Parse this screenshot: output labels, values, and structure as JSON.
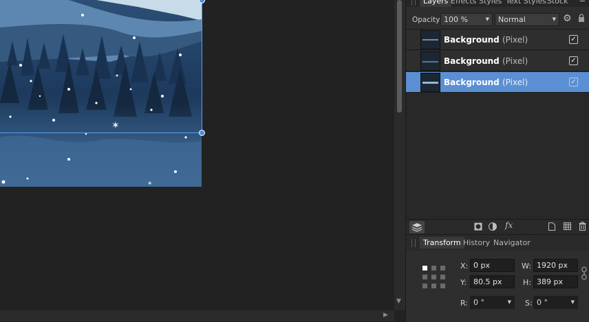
{
  "layers_panel": {
    "tabs": [
      {
        "label": "Layers",
        "active": true
      },
      {
        "label": "Effects",
        "active": false
      },
      {
        "label": "Styles",
        "active": false
      },
      {
        "label": "Text Styles",
        "active": false
      },
      {
        "label": "Stock",
        "active": false
      }
    ],
    "opacity_label": "Opacity:",
    "opacity_value": "100 %",
    "blend_mode": "Normal",
    "layers": [
      {
        "name": "Background",
        "type": "(Pixel)",
        "visible": true,
        "selected": false
      },
      {
        "name": "Background",
        "type": "(Pixel)",
        "visible": true,
        "selected": false
      },
      {
        "name": "Background",
        "type": "(Pixel)",
        "visible": true,
        "selected": true
      }
    ],
    "footer_icons": [
      "layers-stack-icon",
      "mask-icon",
      "adjustment-icon",
      "fx-icon",
      "new-layer-icon",
      "group-icon",
      "trash-icon"
    ],
    "fx_glyph": "fx",
    "check_glyph": "✓"
  },
  "transform_panel": {
    "tabs": [
      {
        "label": "Transform",
        "active": true
      },
      {
        "label": "History",
        "active": false
      },
      {
        "label": "Navigator",
        "active": false
      }
    ],
    "x_label": "X:",
    "x_value": "0 px",
    "y_label": "Y:",
    "y_value": "80.5 px",
    "w_label": "W:",
    "w_value": "1920 px",
    "h_label": "H:",
    "h_value": "389 px",
    "r_label": "R:",
    "r_value": "0 °",
    "s_label": "S:",
    "s_value": "0 °"
  },
  "colors": {
    "selection_accent": "#5a9cf0",
    "selected_row": "#5b8fd3",
    "panel_bg": "#2e2e2e",
    "canvas_bg": "#222222"
  }
}
